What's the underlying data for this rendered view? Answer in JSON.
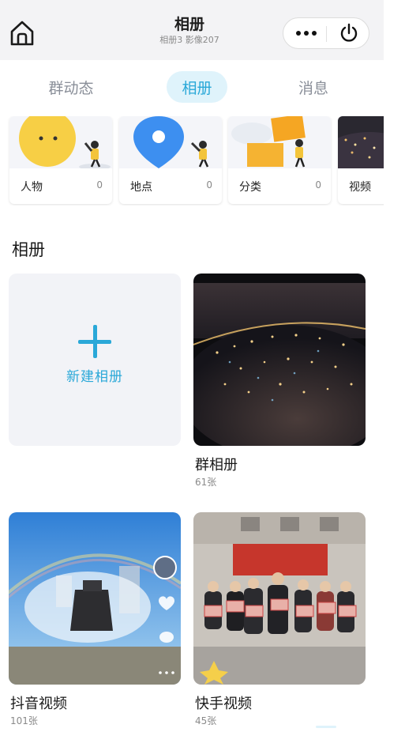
{
  "header": {
    "title": "相册",
    "subtitle": "相册3 影像207",
    "home_icon": "home-icon",
    "more_icon": "more-dots-icon",
    "power_icon": "power-icon"
  },
  "tabs": [
    {
      "label": "群动态",
      "active": false
    },
    {
      "label": "相册",
      "active": true
    },
    {
      "label": "消息",
      "active": false
    }
  ],
  "categories": [
    {
      "name": "人物",
      "count": "0"
    },
    {
      "name": "地点",
      "count": "0"
    },
    {
      "name": "分类",
      "count": "0"
    },
    {
      "name": "视频",
      "count": ""
    }
  ],
  "section": {
    "title": "相册",
    "new_album_label": "新建相册"
  },
  "albums": [
    {
      "name": "群相册",
      "count": "61张"
    },
    {
      "name": "抖音视频",
      "count": "101张"
    },
    {
      "name": "快手视频",
      "count": "45张"
    }
  ],
  "colors": {
    "accent": "#2aa8d8",
    "accent_bg": "#dff3fb",
    "header_bg": "#f3f3f5"
  }
}
